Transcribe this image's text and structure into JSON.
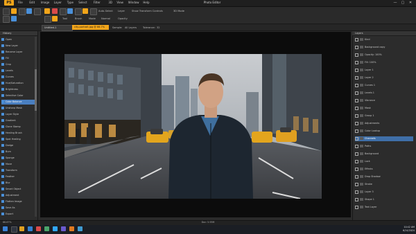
{
  "app": {
    "title": "Photo Editor",
    "logo": "PS"
  },
  "menu": [
    "File",
    "Edit",
    "Image",
    "Layer",
    "Type",
    "Select",
    "Filter",
    "3D",
    "View",
    "Window",
    "Help"
  ],
  "window_controls": [
    "—",
    "▢",
    "✕"
  ],
  "toolbar": {
    "labels": [
      "Auto-Select",
      "Layer",
      "Show Transform Controls",
      "3D Mode"
    ],
    "row2_labels": [
      "Tool",
      "Brush",
      "Mode",
      "Normal",
      "Opacity"
    ]
  },
  "options": {
    "doc_tab": "Untitled-1",
    "active_tab": "city-portrait.jpg @ 66.7%",
    "labels": [
      "Sample:",
      "All Layers",
      "Tolerance:",
      "32"
    ]
  },
  "left_panel": {
    "header": "History",
    "items": [
      "Open",
      "New Layer",
      "Rename Layer",
      "Fill",
      "Crop",
      "Levels",
      "Curves",
      "Hue/Saturation",
      "Brightness",
      "Selective Color",
      "Color Balance",
      "Unsharp Mask",
      "Layer Style",
      "Gradient",
      "Clone Stamp",
      "Healing Brush",
      "Spot Healing",
      "Dodge",
      "Burn",
      "Sponge",
      "Move",
      "Transform",
      "Feather",
      "Blur",
      "Smart Object",
      "Adjustment",
      "Flatten Image",
      "Save As",
      "Export"
    ],
    "selected_index": 10
  },
  "right_panel": {
    "header": "Layers",
    "items": [
      "Kind",
      "Background copy",
      "Opacity: 100%",
      "Fill: 100%",
      "Layer 1",
      "Layer 2",
      "Curves 1",
      "Levels 1",
      "Vibrance",
      "Mask",
      "Group 1",
      "Adjustments",
      "Color Lookup",
      "Channels",
      "Paths",
      "Background",
      "Lock",
      "Effects",
      "Drop Shadow",
      "Stroke",
      "Layer 3",
      "Shape 1",
      "Text Layer"
    ],
    "selected_index": 13,
    "tabs": [
      "Layers",
      "Channels",
      "Paths"
    ]
  },
  "status": {
    "zoom": "66.67%",
    "doc": "Doc: 5.93M"
  },
  "taskbar": {
    "time": "10:42 AM",
    "date": "6/14/2024"
  },
  "colors": {
    "accent": "#f2a51a",
    "selection": "#4a7fc0",
    "panel": "#2c2c2c",
    "canvas_bg": "#0c0c0c"
  }
}
